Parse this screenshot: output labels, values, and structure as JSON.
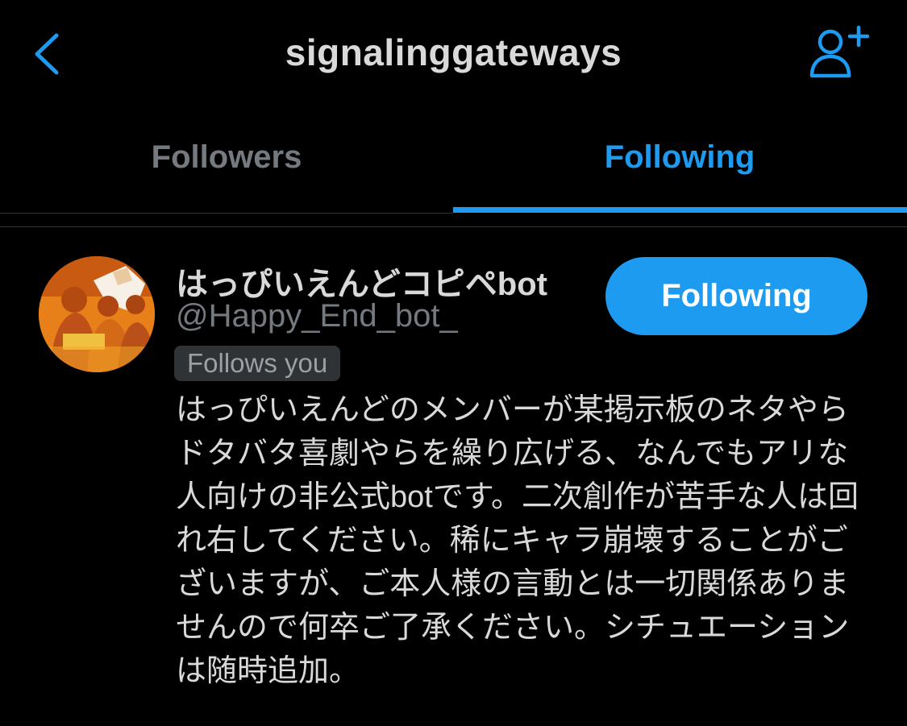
{
  "nav": {
    "title": "signalinggateways",
    "back_icon": "chevron-left-icon",
    "add_user_icon": "person-plus-icon"
  },
  "tabs": [
    {
      "label": "Followers",
      "active": false
    },
    {
      "label": "Following",
      "active": true
    }
  ],
  "user": {
    "display_name": "はっぴいえんどコピペbot",
    "handle": "@Happy_End_bot_",
    "follows_you": "Follows you",
    "follow_button": "Following",
    "bio": "はっぴいえんどのメンバーが某掲示板のネタやらドタバタ喜劇やらを繰り広げる、なんでもアリな人向けの非公式botです。二次創作が苦手な人は回れ右してください。稀にキャラ崩壊することがございますが、ご本人様の言動とは一切関係ありませんので何卒ご了承ください。シチュエーションは随時追加。"
  },
  "colors": {
    "background": "#000000",
    "accent": "#1d9bf0",
    "text_primary": "#d9d9d9",
    "text_secondary": "#747a80",
    "badge_bg": "#2f3336"
  }
}
